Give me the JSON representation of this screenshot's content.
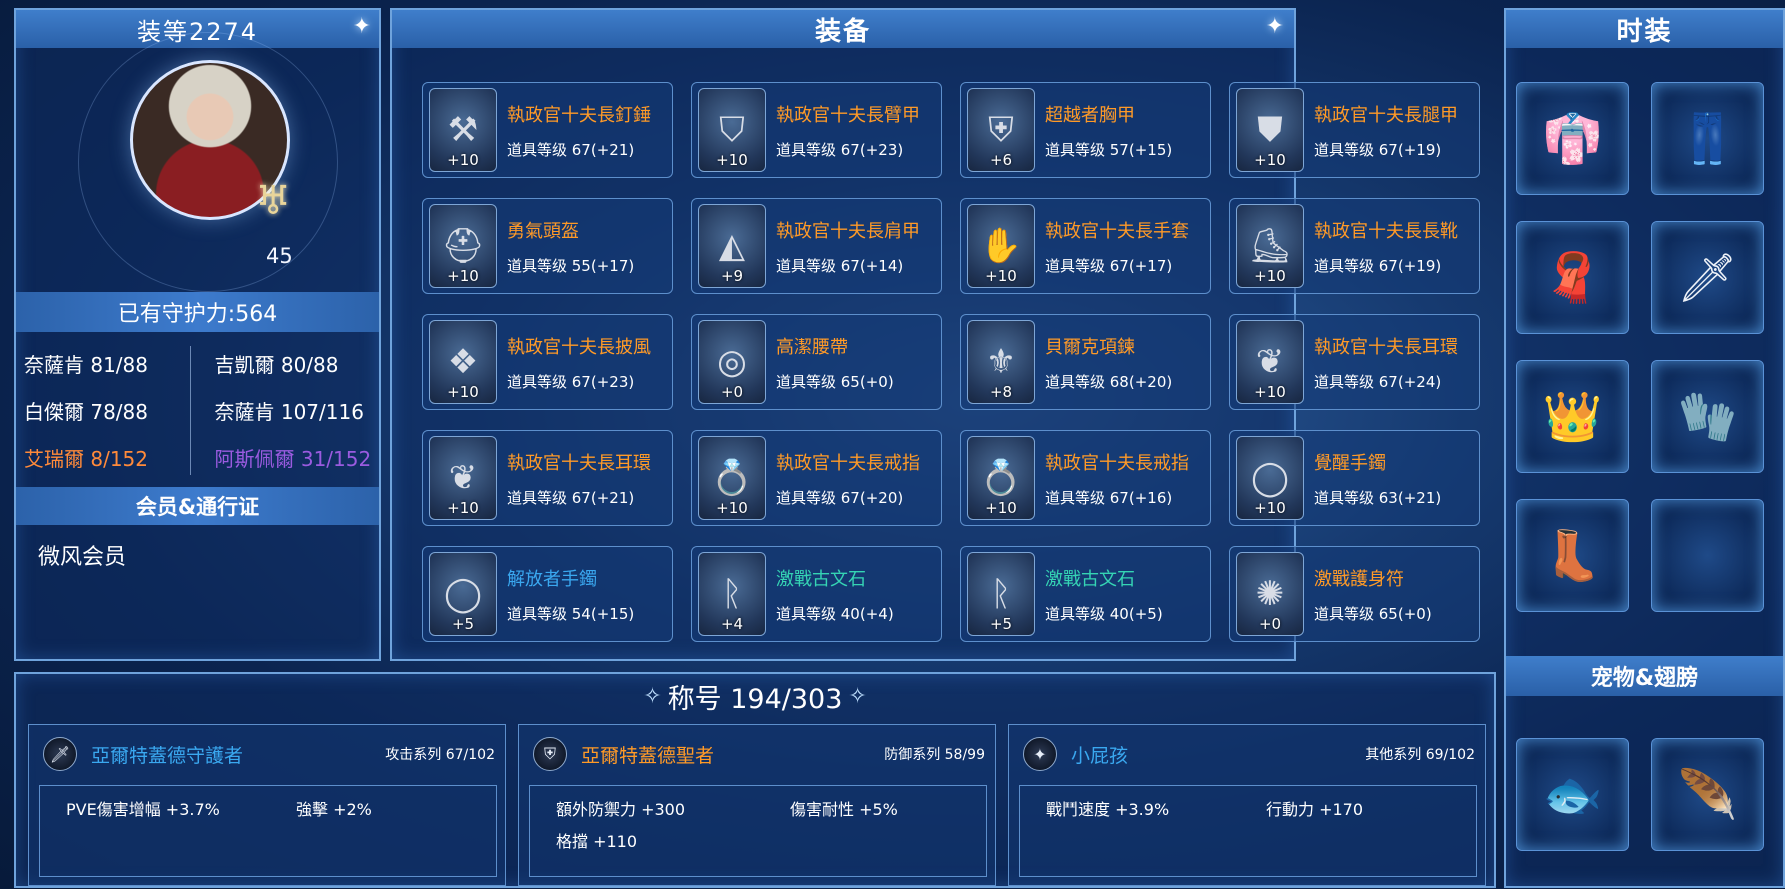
{
  "left": {
    "item_level": "装等2274",
    "character_level": "45",
    "defense": "已有守护力:564",
    "stats": [
      {
        "label": "奈薩肯 81/88",
        "color": "#ffffff"
      },
      {
        "label": "吉凱爾 80/88",
        "color": "#ffffff"
      },
      {
        "label": "白傑爾 78/88",
        "color": "#ffffff"
      },
      {
        "label": "奈薩肯 107/116",
        "color": "#ffffff"
      },
      {
        "label": "艾瑞爾 8/152",
        "color": "#ff8a3a"
      },
      {
        "label": "阿斯佩爾 31/152",
        "color": "#9a5be0"
      }
    ],
    "membership_title": "会员&通行证",
    "membership_value": "微风会员"
  },
  "equipment": {
    "title": "装备",
    "level_prefix": "道具等级",
    "items": [
      {
        "name": "執政官十夫長釘錘",
        "level": "道具等级 67(+21)",
        "enhance": "+10",
        "rarity": "orange",
        "icon": "mace-icon"
      },
      {
        "name": "執政官十夫長臂甲",
        "level": "道具等级 67(+23)",
        "enhance": "+10",
        "rarity": "orange",
        "icon": "bracer-icon"
      },
      {
        "name": "超越者胸甲",
        "level": "道具等级 57(+15)",
        "enhance": "+6",
        "rarity": "orange",
        "icon": "chest-armor-icon"
      },
      {
        "name": "執政官十夫長腿甲",
        "level": "道具等级 67(+19)",
        "enhance": "+10",
        "rarity": "orange",
        "icon": "leg-armor-icon"
      },
      {
        "name": "勇氣頭盔",
        "level": "道具等级 55(+17)",
        "enhance": "+10",
        "rarity": "orange",
        "icon": "helmet-icon"
      },
      {
        "name": "執政官十夫長肩甲",
        "level": "道具等级 67(+14)",
        "enhance": "+9",
        "rarity": "orange",
        "icon": "shoulder-armor-icon"
      },
      {
        "name": "執政官十夫長手套",
        "level": "道具等级 67(+17)",
        "enhance": "+10",
        "rarity": "orange",
        "icon": "gloves-icon"
      },
      {
        "name": "執政官十夫長長靴",
        "level": "道具等级 67(+19)",
        "enhance": "+10",
        "rarity": "orange",
        "icon": "boots-icon"
      },
      {
        "name": "執政官十夫長披風",
        "level": "道具等级 67(+23)",
        "enhance": "+10",
        "rarity": "orange",
        "icon": "cape-icon"
      },
      {
        "name": "高潔腰帶",
        "level": "道具等级 65(+0)",
        "enhance": "+0",
        "rarity": "orange",
        "icon": "belt-icon"
      },
      {
        "name": "貝爾克項鍊",
        "level": "道具等级 68(+20)",
        "enhance": "+8",
        "rarity": "orange",
        "icon": "necklace-icon"
      },
      {
        "name": "執政官十夫長耳環",
        "level": "道具等级 67(+24)",
        "enhance": "+10",
        "rarity": "orange",
        "icon": "earring-icon"
      },
      {
        "name": "執政官十夫長耳環",
        "level": "道具等级 67(+21)",
        "enhance": "+10",
        "rarity": "orange",
        "icon": "earring-icon"
      },
      {
        "name": "執政官十夫長戒指",
        "level": "道具等级 67(+20)",
        "enhance": "+10",
        "rarity": "orange",
        "icon": "ring-icon"
      },
      {
        "name": "執政官十夫長戒指",
        "level": "道具等级 67(+16)",
        "enhance": "+10",
        "rarity": "orange",
        "icon": "ring-icon"
      },
      {
        "name": "覺醒手鐲",
        "level": "道具等级 63(+21)",
        "enhance": "+10",
        "rarity": "orange",
        "icon": "bracelet-icon"
      },
      {
        "name": "解放者手鐲",
        "level": "道具等级 54(+15)",
        "enhance": "+5",
        "rarity": "blue",
        "icon": "bracelet-icon"
      },
      {
        "name": "激戰古文石",
        "level": "道具等级 40(+4)",
        "enhance": "+4",
        "rarity": "teal",
        "icon": "rune-stone-icon"
      },
      {
        "name": "激戰古文石",
        "level": "道具等级 40(+5)",
        "enhance": "+5",
        "rarity": "teal",
        "icon": "rune-stone-icon"
      },
      {
        "name": "激戰護身符",
        "level": "道具等级 65(+0)",
        "enhance": "+0",
        "rarity": "orange",
        "icon": "amulet-icon"
      }
    ]
  },
  "fashion": {
    "title": "时装",
    "slots": [
      {
        "icon": "costume-top-icon",
        "glyph": "👘"
      },
      {
        "icon": "costume-pants-icon",
        "glyph": "👖"
      },
      {
        "icon": "costume-cape-icon",
        "glyph": "🧣"
      },
      {
        "icon": "costume-weapon-icon",
        "glyph": "🗡"
      },
      {
        "icon": "costume-headpiece-icon",
        "glyph": "👑"
      },
      {
        "icon": "costume-gloves-icon",
        "glyph": "🧤"
      },
      {
        "icon": "costume-boots-icon",
        "glyph": "👢"
      },
      {
        "icon": "empty-slot-icon",
        "glyph": ""
      }
    ],
    "pet_title": "宠物&翅膀",
    "pets": [
      {
        "icon": "pet-icon",
        "glyph": "🐟"
      },
      {
        "icon": "wings-icon",
        "glyph": "🪶"
      }
    ]
  },
  "titles": {
    "header": "称号 194/303",
    "boxes": [
      {
        "name": "亞爾特蓋德守護者",
        "name_color": "blue",
        "series": "攻击系列 67/102",
        "icon": "sword-icon",
        "stats": [
          "PVE傷害增幅 +3.7%",
          "強擊 +2%"
        ]
      },
      {
        "name": "亞爾特蓋德聖者",
        "name_color": "orange",
        "series": "防御系列 58/99",
        "icon": "shield-icon",
        "stats": [
          "額外防禦力 +300",
          "傷害耐性 +5%",
          "格擋 +110"
        ]
      },
      {
        "name": "小屁孩",
        "name_color": "blue",
        "series": "其他系列 69/102",
        "icon": "star-icon",
        "stats": [
          "戰鬥速度 +3.9%",
          "行動力 +170"
        ]
      }
    ]
  }
}
